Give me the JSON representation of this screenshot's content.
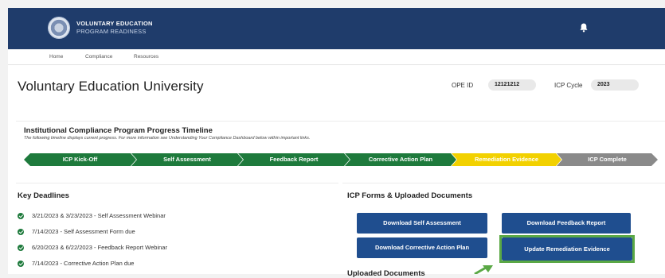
{
  "header": {
    "brand_line1": "VOLUNTARY EDUCATION",
    "brand_line2": "PROGRAM READINESS",
    "bg_color": "#1f3c6b",
    "icons": [
      "seal-logo",
      "bell-icon"
    ]
  },
  "nav": {
    "items": [
      {
        "label": "Home"
      },
      {
        "label": "Compliance"
      },
      {
        "label": "Resources"
      }
    ]
  },
  "page": {
    "title": "Voluntary Education University",
    "ope_label": "OPE ID",
    "ope_value": "12121212",
    "cycle_label": "ICP Cycle",
    "cycle_value": "2023"
  },
  "timeline": {
    "title": "Institutional Compliance Program Progress Timeline",
    "description": "The following timeline displays current progress. For more information see Understanding Your Compliance Dashboard below within important links.",
    "steps": [
      {
        "label": "ICP Kick-Off",
        "status": "complete",
        "color": "#1e7a3c"
      },
      {
        "label": "Self Assessment",
        "status": "complete",
        "color": "#1e7a3c"
      },
      {
        "label": "Feedback Report",
        "status": "complete",
        "color": "#1e7a3c"
      },
      {
        "label": "Corrective Action Plan",
        "status": "complete",
        "color": "#1e7a3c"
      },
      {
        "label": "Remediation Evidence",
        "status": "current",
        "color": "#f2d100"
      },
      {
        "label": "ICP Complete",
        "status": "pending",
        "color": "#8a8a8a"
      }
    ]
  },
  "deadlines": {
    "title": "Key Deadlines",
    "items": [
      {
        "text": "3/21/2023 & 3/23/2023 - Self Assessment Webinar"
      },
      {
        "text": "7/14/2023 - Self Assessment Form due"
      },
      {
        "text": "6/20/2023 & 6/22/2023 - Feedback Report Webinar"
      },
      {
        "text": "7/14/2023 - Corrective Action Plan due"
      }
    ]
  },
  "forms": {
    "title": "ICP Forms & Uploaded Documents",
    "buttons": [
      {
        "label": "Download Self Assessment"
      },
      {
        "label": "Download Feedback Report"
      },
      {
        "label": "Download Corrective Action Plan"
      },
      {
        "label": "Update Remediation Evidence"
      }
    ],
    "uploaded_title": "Uploaded Documents",
    "highlight_color": "#5aa845"
  }
}
